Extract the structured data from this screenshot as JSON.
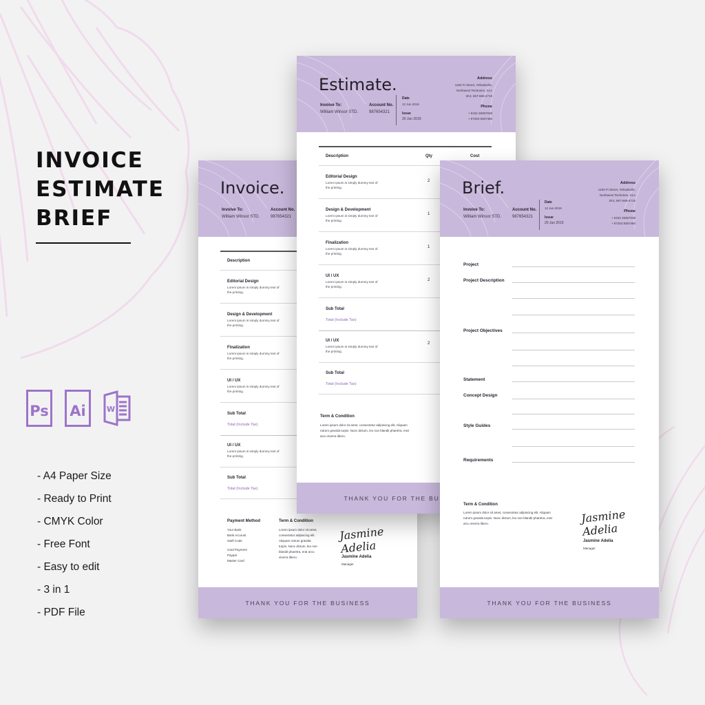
{
  "left_panel": {
    "title_lines": [
      "INVOICE",
      "ESTIMATE",
      "BRIEF"
    ],
    "app_icons": [
      {
        "name": "photoshop-icon",
        "label": "Ps"
      },
      {
        "name": "illustrator-icon",
        "label": "Ai"
      },
      {
        "name": "word-icon",
        "label": "W"
      }
    ],
    "features": [
      "- A4 Paper Size",
      "- Ready to Print",
      "- CMYK Color",
      "- Free Font",
      "- Easy to edit",
      "- 3 in 1",
      "- PDF File"
    ]
  },
  "colors": {
    "accent": "#c8b8db",
    "icon_purple": "#9b74c9",
    "total_purple": "#8a66b5",
    "flower_pink": "#f0dbeb",
    "background": "#f3f2f3"
  },
  "common": {
    "invoice_to_label": "Invoive To:",
    "client_name": "William Winsor STD.",
    "account_label": "Account No.",
    "account_no": "987654321",
    "date_label": "Date",
    "date_value": "12 Jun 2019",
    "issue_label": "Issue",
    "issue_value": "20 Jun 2019",
    "address_label": "Address",
    "address_lines": [
      "1183 Ft Street, Yellowknife,",
      "Northwest Territories, X1A",
      "2K3, 867-669-4719"
    ],
    "phone_label": "Phone",
    "phone_lines": [
      "+ 6152 28367038",
      "+ 87263 8367480"
    ],
    "footer_text": "THANK YOU FOR THE BUSINESS",
    "lorem_short": "Lorem ipsum is simply dummy text of the printing.",
    "term_label": "Term & Condition",
    "term_text": "Lorem ipsum dolor sit amet, consectetur adipiscing elit. Aliquam rutrum gravida turpis. Nunc dictum, leo non blandit pharetra, erat arcu viverra libero.",
    "signature": "Jasmine Adelia",
    "signer_name": "Jasmine Adelia",
    "signer_role": "Manager",
    "sub_total": "Sub Total",
    "total_tax": "Total (Include Tax)"
  },
  "invoice": {
    "title": "Invoice.",
    "col_description": "Description",
    "items": [
      {
        "title": "Editorial Design"
      },
      {
        "title": "Design & Development"
      },
      {
        "title": "Finalization"
      },
      {
        "title": "UI / UX"
      }
    ],
    "extra_item": {
      "title": "UI / UX"
    },
    "payment_label": "Payment Method",
    "payment_lines_a": [
      "Your Bank",
      "Bank Account",
      "Swift Code"
    ],
    "payment_lines_b": [
      "Card Payment",
      "Paypal",
      "Master Card"
    ]
  },
  "estimate": {
    "title": "Estimate.",
    "col_description": "Description",
    "col_qty": "Qty",
    "col_cost": "Cost",
    "items": [
      {
        "title": "Editorial Design",
        "qty": "2"
      },
      {
        "title": "Design & Development",
        "qty": "1"
      },
      {
        "title": "Finalization",
        "qty": "1"
      },
      {
        "title": "UI / UX",
        "qty": "2"
      }
    ],
    "extra_item": {
      "title": "UI / UX",
      "qty": "2"
    },
    "footer_text": "THANK YOU FOR THE BUSI"
  },
  "brief": {
    "title": "Brief.",
    "fields": [
      {
        "label": "Project"
      },
      {
        "label": "Project Description"
      },
      {
        "label": "Project Objectives"
      },
      {
        "label": "Statement"
      },
      {
        "label": "Concept Design"
      },
      {
        "label": "Style Guides"
      },
      {
        "label": "Requirements"
      }
    ]
  }
}
